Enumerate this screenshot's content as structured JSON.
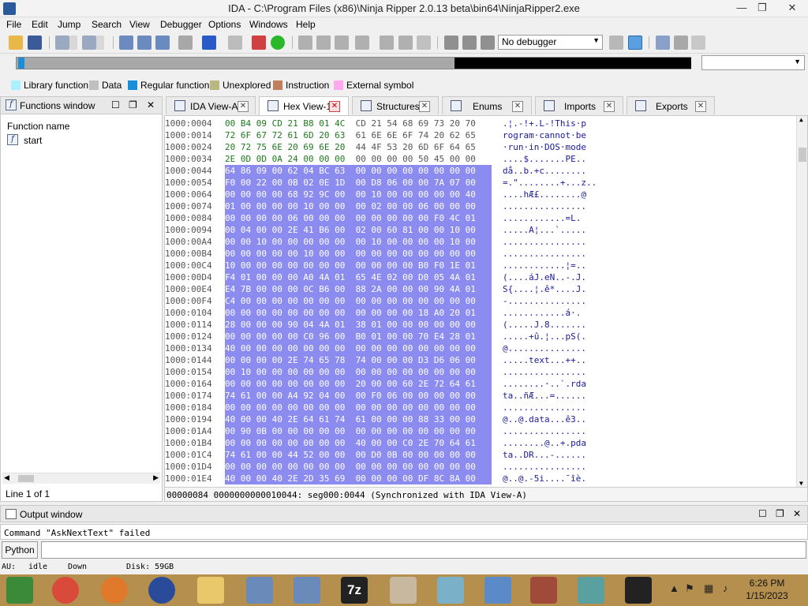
{
  "window": {
    "title": "IDA - C:\\Program Files (x86)\\Ninja Ripper 2.0.13 beta\\bin64\\NinjaRipper2.exe",
    "minimize": "—",
    "restore": "❐",
    "close": "✕"
  },
  "menu": [
    "File",
    "Edit",
    "Jump",
    "Search",
    "View",
    "Debugger",
    "Options",
    "Windows",
    "Help"
  ],
  "toolbar": {
    "debugger_select": "No debugger"
  },
  "legend": [
    {
      "label": "Library function",
      "color": "#aaf0ff"
    },
    {
      "label": "Data",
      "color": "#c0c0c0"
    },
    {
      "label": "Regular function",
      "color": "#1a8fd8"
    },
    {
      "label": "Unexplored",
      "color": "#b8b880"
    },
    {
      "label": "Instruction",
      "color": "#c08060"
    },
    {
      "label": "External symbol",
      "color": "#ffaaee"
    }
  ],
  "functions_window": {
    "title": "Functions window",
    "column_header": "Function name",
    "items": [
      {
        "icon": "f",
        "name": "start"
      }
    ],
    "status": "Line 1 of 1"
  },
  "tabs": [
    {
      "label": "IDA View-A",
      "active": false
    },
    {
      "label": "Hex View-1",
      "active": true
    },
    {
      "label": "Structures",
      "active": false
    },
    {
      "label": "Enums",
      "active": false
    },
    {
      "label": "Imports",
      "active": false
    },
    {
      "label": "Exports",
      "active": false
    }
  ],
  "hex_rows": [
    {
      "addr": "1000:0004",
      "hex": "00 B4 09 CD 21 B8 01 4C  CD 21 54 68 69 73 20 70",
      "ascii": ".¦.-!+.L-!This·p"
    },
    {
      "addr": "1000:0014",
      "hex": "72 6F 67 72 61 6D 20 63  61 6E 6E 6F 74 20 62 65",
      "ascii": "rogram·cannot·be"
    },
    {
      "addr": "1000:0024",
      "hex": "20 72 75 6E 20 69 6E 20  44 4F 53 20 6D 6F 64 65",
      "ascii": "·run·in·DOS·mode"
    },
    {
      "addr": "1000:0034",
      "hex": "2E 0D 0D 0A 24 00 00 00  00 00 00 00 50 45 00 00",
      "ascii": "....$.......PE.."
    },
    {
      "addr": "1000:0044",
      "hex": "64 86 09 00 62 04 BC 63  00 00 00 00 00 00 00 00",
      "ascii": "då..b.+c........"
    },
    {
      "addr": "1000:0054",
      "hex": "F0 00 22 00 0B 02 0E 1D  00 D8 06 00 00 7A 07 00",
      "ascii": "=.\"........+...z.."
    },
    {
      "addr": "1000:0064",
      "hex": "00 00 00 00 68 92 9C 00  00 10 00 00 00 00 00 40",
      "ascii": "....hÆ£........@"
    },
    {
      "addr": "1000:0074",
      "hex": "01 00 00 00 00 10 00 00  00 02 00 00 06 00 00 00",
      "ascii": "................"
    },
    {
      "addr": "1000:0084",
      "hex": "00 00 00 00 06 00 00 00  00 00 00 00 00 F0 4C 01",
      "ascii": "............=L."
    },
    {
      "addr": "1000:0094",
      "hex": "00 04 00 00 2E 41 B6 00  02 00 60 81 00 00 10 00",
      "ascii": ".....A¦...`....."
    },
    {
      "addr": "1000:00A4",
      "hex": "00 00 10 00 00 00 00 00  00 10 00 00 00 00 10 00",
      "ascii": "................"
    },
    {
      "addr": "1000:00B4",
      "hex": "00 00 00 00 00 10 00 00  00 00 00 00 00 00 00 00",
      "ascii": "................"
    },
    {
      "addr": "1000:00C4",
      "hex": "10 00 00 00 00 00 00 00  00 00 00 00 B0 F0 1E 01",
      "ascii": "............¦=.."
    },
    {
      "addr": "1000:00D4",
      "hex": "F4 01 00 00 00 A0 4A 01  65 4E 02 00 D0 05 4A 01",
      "ascii": "(....áJ.eN..-.J."
    },
    {
      "addr": "1000:00E4",
      "hex": "E4 7B 00 00 00 0C B6 00  88 2A 00 00 00 90 4A 01",
      "ascii": "S{....¦.ê*....J."
    },
    {
      "addr": "1000:00F4",
      "hex": "C4 00 00 00 00 00 00 00  00 00 00 00 00 00 00 00",
      "ascii": "-..............."
    },
    {
      "addr": "1000:0104",
      "hex": "00 00 00 00 00 00 00 00  00 00 00 00 18 A0 20 01",
      "ascii": "............á·."
    },
    {
      "addr": "1000:0114",
      "hex": "28 00 00 00 90 04 4A 01  38 01 00 00 00 00 00 00",
      "ascii": "(.....J.8......."
    },
    {
      "addr": "1000:0124",
      "hex": "00 00 00 00 00 C0 96 00  B0 01 00 00 70 E4 28 01",
      "ascii": ".....+û.¦...pS(."
    },
    {
      "addr": "1000:0134",
      "hex": "40 00 00 00 00 00 00 00  00 00 00 00 00 00 00 00",
      "ascii": "@..............."
    },
    {
      "addr": "1000:0144",
      "hex": "00 00 00 00 2E 74 65 78  74 00 00 00 D3 D6 06 00",
      "ascii": ".....text...++.."
    },
    {
      "addr": "1000:0154",
      "hex": "00 10 00 00 00 00 00 00  00 00 00 00 00 00 00 00",
      "ascii": "................"
    },
    {
      "addr": "1000:0164",
      "hex": "00 00 00 00 00 00 00 00  20 00 00 60 2E 72 64 61",
      "ascii": "........·..`.rda"
    },
    {
      "addr": "1000:0174",
      "hex": "74 61 00 00 A4 92 04 00  00 F0 06 00 00 00 00 00",
      "ascii": "ta..ñÆ...=......"
    },
    {
      "addr": "1000:0184",
      "hex": "00 00 00 00 00 00 00 00  00 00 00 00 00 00 00 00",
      "ascii": "................"
    },
    {
      "addr": "1000:0194",
      "hex": "40 00 00 40 2E 64 61 74  61 00 00 00 88 33 00 00",
      "ascii": "@..@.data...ê3.."
    },
    {
      "addr": "1000:01A4",
      "hex": "00 90 0B 00 00 00 00 00  00 00 00 00 00 00 00 00",
      "ascii": "................"
    },
    {
      "addr": "1000:01B4",
      "hex": "00 00 00 00 00 00 00 00  40 00 00 C0 2E 70 64 61",
      "ascii": "........@..+.pda"
    },
    {
      "addr": "1000:01C4",
      "hex": "74 61 00 00 44 52 00 00  00 D0 0B 00 00 00 00 00",
      "ascii": "ta..DR...-......"
    },
    {
      "addr": "1000:01D4",
      "hex": "00 00 00 00 00 00 00 00  00 00 00 00 00 00 00 00",
      "ascii": "................"
    },
    {
      "addr": "1000:01E4",
      "hex": "40 00 00 40 2E 2D 35 69  00 00 00 00 DF 8C 8A 00",
      "ascii": "@..@.-5i....¯îè."
    }
  ],
  "hex_selection_start_row": 4,
  "hex_status": "00000084 0000000000010044: seg000:0044 (Synchronized with IDA View-A)",
  "output_window": {
    "title": "Output window",
    "text": "Command \"AskNextText\" failed"
  },
  "command": {
    "lang_button": "Python",
    "value": ""
  },
  "statusbar": {
    "au": "AU:",
    "au_state": "idle",
    "direction": "Down",
    "disk": "Disk: 59GB"
  },
  "taskbar": {
    "time": "6:26 PM",
    "date": "1/15/2023",
    "zip_label": "7z"
  }
}
